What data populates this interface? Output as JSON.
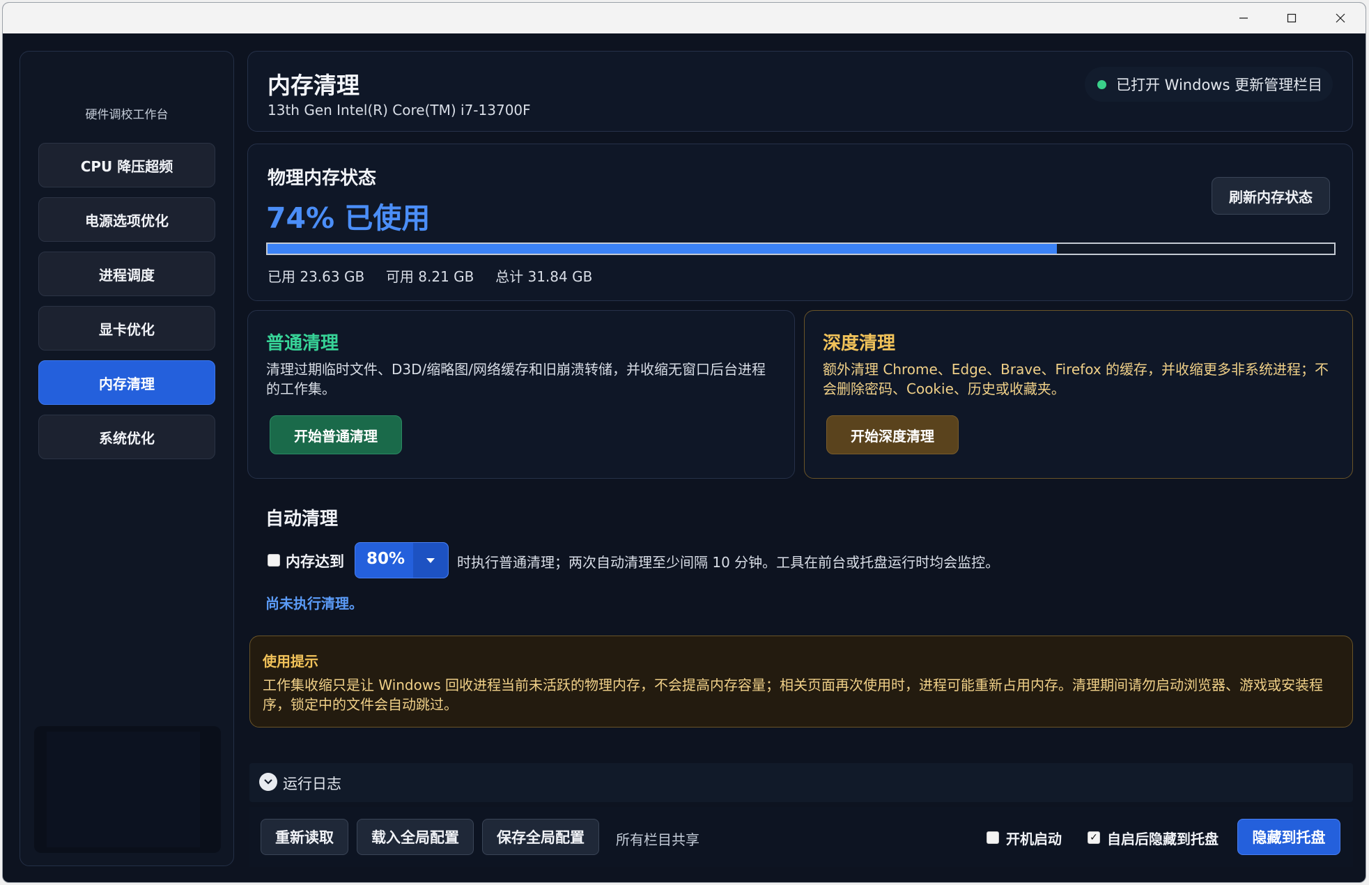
{
  "sidebar": {
    "title": "硬件调校工作台",
    "items": [
      {
        "label": "CPU 降压超频"
      },
      {
        "label": "电源选项优化"
      },
      {
        "label": "进程调度"
      },
      {
        "label": "显卡优化"
      },
      {
        "label": "内存清理",
        "active": true
      },
      {
        "label": "系统优化"
      }
    ]
  },
  "header": {
    "title": "内存清理",
    "subtitle": "13th Gen Intel(R) Core(TM) i7-13700F",
    "badge": "已打开 Windows 更新管理栏目"
  },
  "memory_status": {
    "title": "物理内存状态",
    "usage_text": "74% 已使用",
    "usage_fraction": 0.74,
    "refresh_label": "刷新内存状态",
    "used": "已用 23.63 GB",
    "available": "可用 8.21 GB",
    "total": "总计 31.84 GB"
  },
  "normal_clean": {
    "title": "普通清理",
    "desc": "清理过期临时文件、D3D/缩略图/网络缓存和旧崩溃转储，并收缩无窗口后台进程的工作集。",
    "button": "开始普通清理"
  },
  "deep_clean": {
    "title": "深度清理",
    "desc": "额外清理 Chrome、Edge、Brave、Firefox 的缓存，并收缩更多非系统进程；不会删除密码、Cookie、历史或收藏夹。",
    "button": "开始深度清理"
  },
  "auto_clean": {
    "title": "自动清理",
    "checkbox_label": "内存达到",
    "checked": false,
    "threshold": "80%",
    "description": "时执行普通清理；两次自动清理至少间隔 10 分钟。工具在前台或托盘运行时均会监控。",
    "status": "尚未执行清理。"
  },
  "tip": {
    "title": "使用提示",
    "text": "工作集收缩只是让 Windows 回收进程当前未活跃的物理内存，不会提高内存容量；相关页面再次使用时，进程可能重新占用内存。清理期间请勿启动浏览器、游戏或安装程序，锁定中的文件会自动跳过。"
  },
  "log": {
    "label": "运行日志"
  },
  "bottom": {
    "reload": "重新读取",
    "load_global": "载入全局配置",
    "save_global": "保存全局配置",
    "shared_note": "所有栏目共享",
    "autostart_label": "开机启动",
    "autostart_checked": false,
    "hide_on_start_label": "自启后隐藏到托盘",
    "hide_on_start_checked": true,
    "check_mark": "✓",
    "hide_tray": "隐藏到托盘"
  },
  "colors": {
    "accent": "#2460dc",
    "usage_text": "#4b8ef7",
    "normal_title": "#37d397",
    "deep_title": "#f2c35a",
    "tip_title": "#f2c35a",
    "status_link": "#5b9bf7"
  }
}
